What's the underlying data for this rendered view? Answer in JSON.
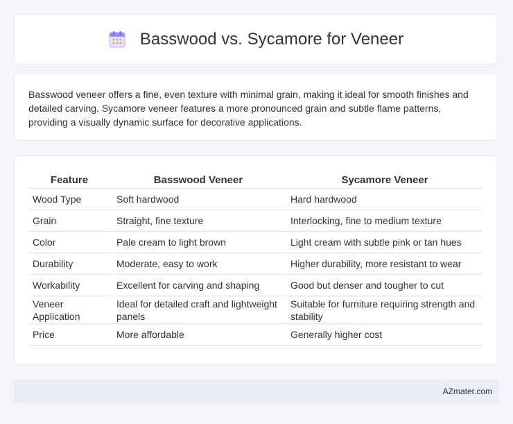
{
  "header": {
    "icon": "calendar-icon",
    "title": "Basswood vs. Sycamore for Veneer"
  },
  "intro": {
    "text": "Basswood veneer offers a fine, even texture with minimal grain, making it ideal for smooth finishes and detailed carving. Sycamore veneer features a more pronounced grain and subtle flame patterns, providing a visually dynamic surface for decorative applications."
  },
  "table": {
    "headers": [
      "Feature",
      "Basswood Veneer",
      "Sycamore Veneer"
    ],
    "rows": [
      [
        "Wood Type",
        "Soft hardwood",
        "Hard hardwood"
      ],
      [
        "Grain",
        "Straight, fine texture",
        "Interlocking, fine to medium texture"
      ],
      [
        "Color",
        "Pale cream to light brown",
        "Light cream with subtle pink or tan hues"
      ],
      [
        "Durability",
        "Moderate, easy to work",
        "Higher durability, more resistant to wear"
      ],
      [
        "Workability",
        "Excellent for carving and shaping",
        "Good but denser and tougher to cut"
      ],
      [
        "Veneer Application",
        "Ideal for detailed craft and lightweight panels",
        "Suitable for furniture requiring strength and stability"
      ],
      [
        "Price",
        "More affordable",
        "Generally higher cost"
      ]
    ]
  },
  "footer": {
    "brand": "AZmater.com"
  },
  "colors": {
    "page_background": "#f4f6fb",
    "card_background": "#ffffff",
    "footer_background": "#e8edf7",
    "icon_accent": "#8e7cf3"
  }
}
